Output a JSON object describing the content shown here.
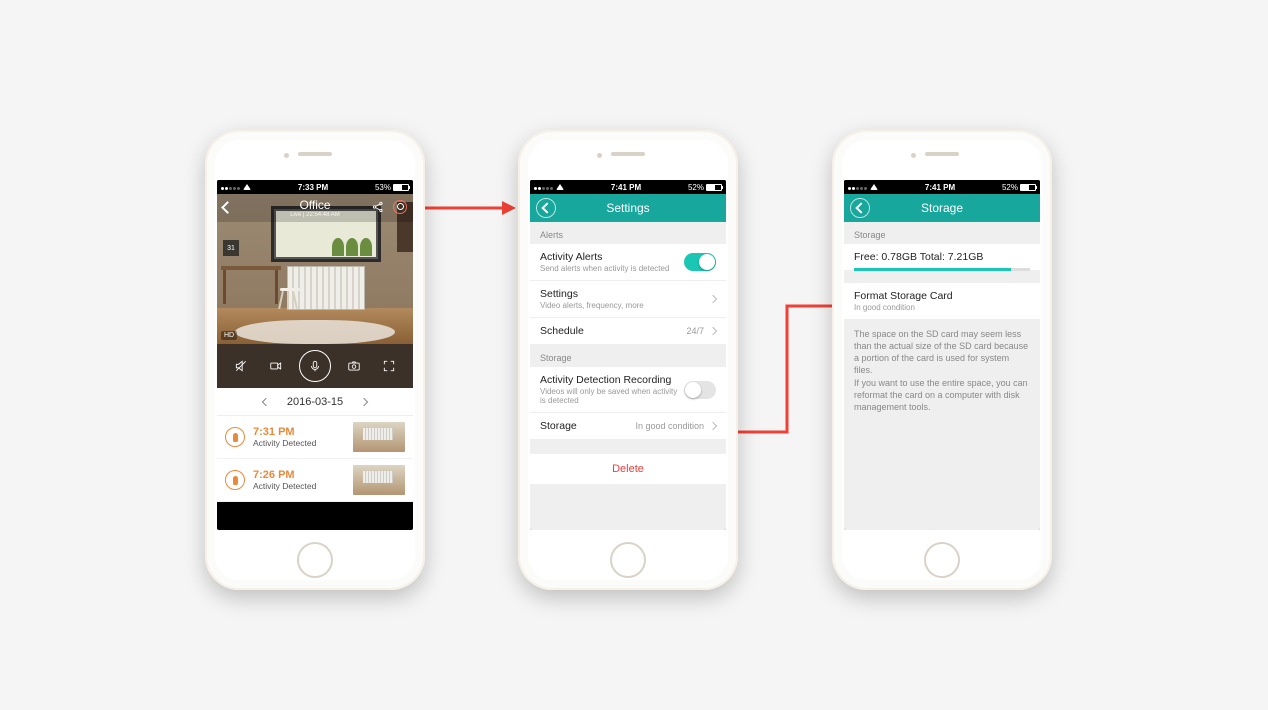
{
  "status": {
    "time1": "7:33 PM",
    "batt1": "53%",
    "time2": "7:41 PM",
    "batt2": "52%",
    "time3": "7:41 PM",
    "batt3": "52%"
  },
  "p1": {
    "title": "Office",
    "subtitle": "Live | 22:54:48 AM",
    "hd": "HD",
    "calendar": "31",
    "date": "2016-03-15",
    "events": [
      {
        "time": "7:31 PM",
        "label": "Activity Detected"
      },
      {
        "time": "7:26 PM",
        "label": "Activity Detected"
      }
    ]
  },
  "p2": {
    "title": "Settings",
    "sections": {
      "alerts": "Alerts",
      "storage": "Storage"
    },
    "alerts": {
      "activity": {
        "title": "Activity Alerts",
        "sub": "Send alerts when activity is detected"
      },
      "settings": {
        "title": "Settings",
        "sub": "Video alerts, frequency, more"
      },
      "schedule": {
        "title": "Schedule",
        "status": "24/7"
      }
    },
    "storage": {
      "adr": {
        "title": "Activity Detection Recording",
        "sub": "Videos will only be saved when activity is detected"
      },
      "stor": {
        "title": "Storage",
        "status": "In good condition"
      }
    },
    "delete": "Delete"
  },
  "p3": {
    "title": "Storage",
    "section": "Storage",
    "free": "Free: 0.78GB Total: 7.21GB",
    "progress_pct": 89,
    "format": {
      "title": "Format Storage Card",
      "sub": "In good condition"
    },
    "para1": "The space on the SD card may seem less than the actual size of the SD card because a portion of the card is used for system files.",
    "para2": "If you want to use the entire space, you can reformat the card on a computer with disk management tools."
  }
}
